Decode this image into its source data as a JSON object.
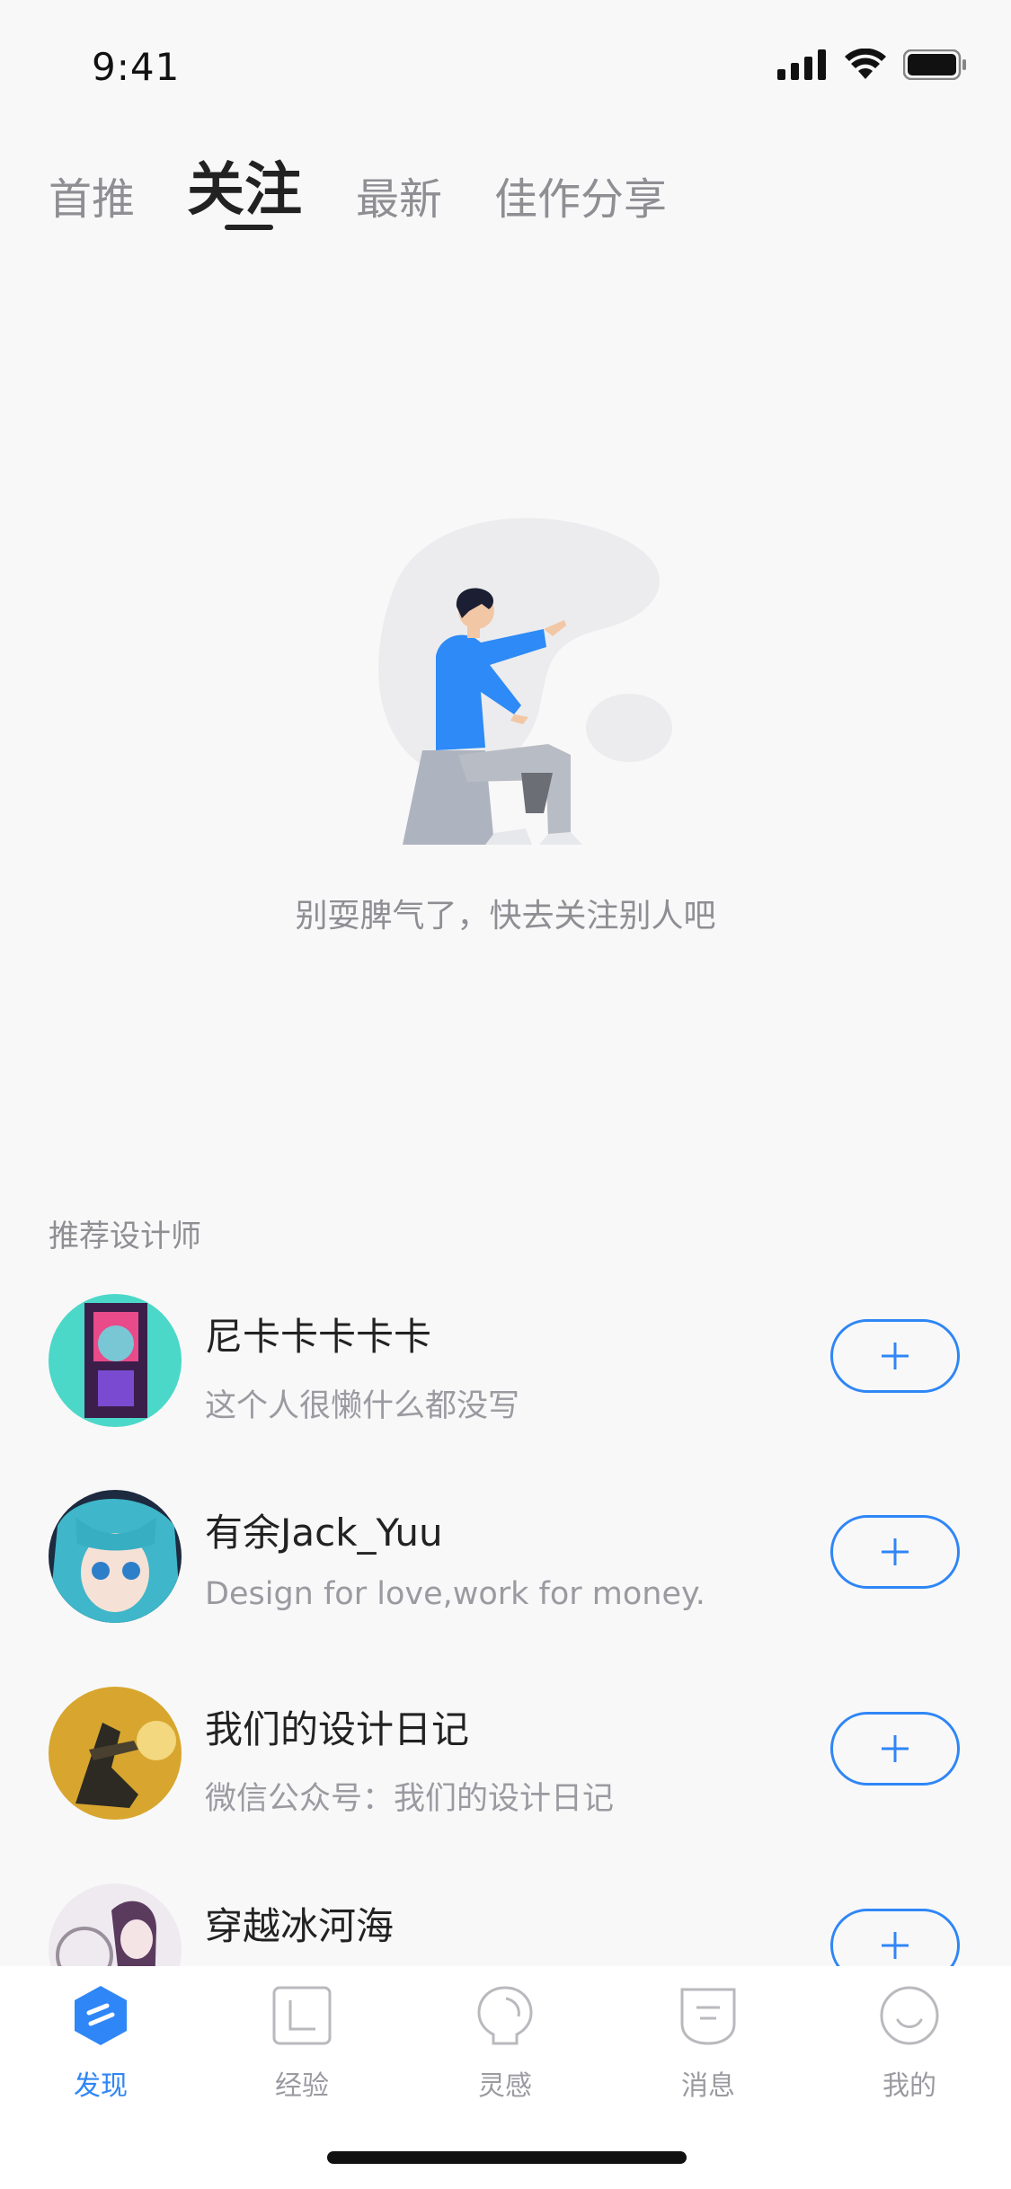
{
  "status_bar": {
    "time": "9:41"
  },
  "tabs": [
    {
      "label": "首推",
      "active": false
    },
    {
      "label": "关注",
      "active": true
    },
    {
      "label": "最新",
      "active": false
    },
    {
      "label": "佳作分享",
      "active": false
    }
  ],
  "empty_state": {
    "message": "别耍脾气了，快去关注别人吧"
  },
  "recommended": {
    "title": "推荐设计师",
    "designers": [
      {
        "name": "尼卡卡卡卡卡",
        "description": "这个人很懒什么都没写",
        "follow_label": "+"
      },
      {
        "name": "有余Jack_Yuu",
        "description": "Design for love,work for money.",
        "follow_label": "+"
      },
      {
        "name": "我们的设计日记",
        "description": "微信公众号：我们的设计日记",
        "follow_label": "+"
      },
      {
        "name": "穿越冰河海",
        "description": "",
        "follow_label": "+"
      }
    ]
  },
  "tab_bar": {
    "items": [
      {
        "label": "发现",
        "icon": "discover-icon",
        "active": true
      },
      {
        "label": "经验",
        "icon": "experience-icon",
        "active": false
      },
      {
        "label": "灵感",
        "icon": "inspiration-icon",
        "active": false
      },
      {
        "label": "消息",
        "icon": "message-icon",
        "active": false
      },
      {
        "label": "我的",
        "icon": "profile-icon",
        "active": false
      }
    ]
  },
  "colors": {
    "accent": "#2f86f6",
    "background": "#f8f8f9"
  }
}
